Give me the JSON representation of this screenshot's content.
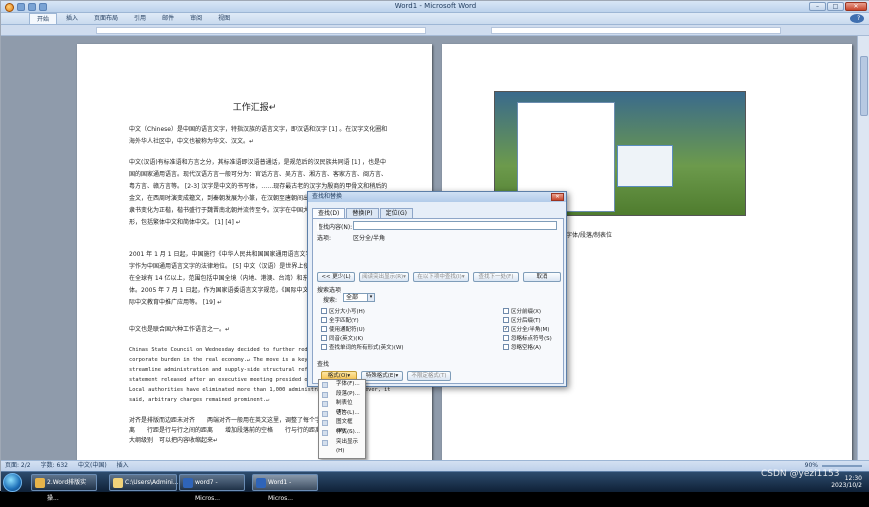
{
  "window": {
    "title": "Word1 - Microsoft Word",
    "min": "–",
    "max": "□",
    "close": "✕"
  },
  "ribbon_tabs": [
    "开始",
    "插入",
    "页面布局",
    "引用",
    "邮件",
    "审阅",
    "视图"
  ],
  "page1": {
    "title": "工作汇报↵",
    "paragraphs": [
      "中文（Chinese）是中国的语言文字，特指汉族的语言文字，即汉语和汉字 [1] 。在汉字文化圈和海外华人社区中，中文也被称为华文、汉文。↵",
      "中文(汉语)有标准语和方言之分，其标准语即汉语普通话，是规范后的汉民族共同语 [1] ，也是中国的国家通用语言。现代汉语方言一般可分为：官话方言、吴方言、湘方言、客家方言、闽方言、粤方言、赣方言等。 [2-3] 汉字是中文的书写体，……现存最古老的汉字为殷商的甲骨文和稍后的金文，在西周时演变成籀文，到秦朝发展为小篆，在汉朝至唐朝间出现楷书，楷书盛行，到了汉末隶书变化为正楷，楷书盛行于魏晋南北朝并流传至今。汉字在中国大陆通用简化字并写字正楷字形，包括繁体中文和简体中文。 [1] [4] ↵",
      "2001 年 1 月 1 日起，中国施行《中华人民共和国国家通用语言文字法》，确立了普通话和规范汉字作为中国通用语言文字的法律地位。 [5] 中文（汉语）是世界上使用人数最多的语言之一，目前在全球有 14 亿以上，范围包括中国全境（内地、港澳、台湾）和东亚、东南亚等地区的华人群体。2005 年 7 月 1 日起，作为国家语委语言文字规范，《国际中文教育中文水平等级标准》在国际中文教育中推广应用等。 [19] ↵",
      "中文也是联合国六种工作语言之一。↵"
    ],
    "english": "Chinas State Council on Wednesday decided to further reduce charges to lower the corporate burden in the real economy.↵ The move is a key part of the drive to streamline administration and supply-side structural reform, according to a statement released after an executive meeting presided over by Premier Li Keqiang. Local authorities have eliminated more than 1,000 administrative fees. However, it said, arbitrary charges remained prominent.↵",
    "tail_lines": [
      "对齐是排版而边距未对齐　　两端对齐一般用在英文这里，调整了每个字之间的距离",
      "离　　行距是行与行之间的距离　　增加段落前的空格　　行与行的距离",
      "大纲级别　可以把内容收缩起来↵"
    ]
  },
  "page2": {
    "caption": "字体/段落/制表位"
  },
  "status": {
    "page": "页面: 2/2",
    "words": "字数: 632",
    "lang": "中文(中国)",
    "mode": "插入",
    "zoom": "90%"
  },
  "dialog": {
    "title": "查找和替换",
    "close": "✕",
    "tabs": [
      "查找(D)",
      "替换(P)",
      "定位(G)"
    ],
    "find_label": "查找内容(N):",
    "find_value": "",
    "options_label": "选项:",
    "options_value": "区分全/半角",
    "buttons": {
      "less": "<< 更少(L)",
      "highlight": "阅读突出显示(R)▾",
      "find_in": "在以下项中查找(I)▾",
      "find_next": "查找下一处(F)",
      "cancel": "取消"
    },
    "search_options_title": "搜索选项",
    "search_label": "搜索:",
    "search_value": "全部",
    "left_checks": [
      "区分大小写(H)",
      "全字匹配(Y)",
      "使用通配符(U)",
      "同音(英文)(K)",
      "查找单词的所有形式(英文)(W)"
    ],
    "right_checks": [
      "区分前缀(X)",
      "区分后缀(T)",
      "区分全/半角(M)",
      "忽略标点符号(S)",
      "忽略空格(A)"
    ],
    "right_checked": [
      false,
      false,
      true,
      false,
      false
    ],
    "find_section": "查找",
    "format_btn": "格式(O)▾",
    "special_btn": "特殊格式(E)▾",
    "noformat_btn": "不限定格式(T)"
  },
  "format_menu": [
    "字体(F)...",
    "段落(P)...",
    "制表位(T)...",
    "语言(L)...",
    "图文框(M)...",
    "样式(S)...",
    "突出显示(H)"
  ],
  "taskbar": {
    "items": [
      "2.Word排版实操...",
      "C:\\Users\\Admini...",
      "word7 - Micros...",
      "Word1 - Micros..."
    ],
    "time": "12:30",
    "date": "2023/10/2"
  },
  "watermark": "CSDN @yezi1153"
}
